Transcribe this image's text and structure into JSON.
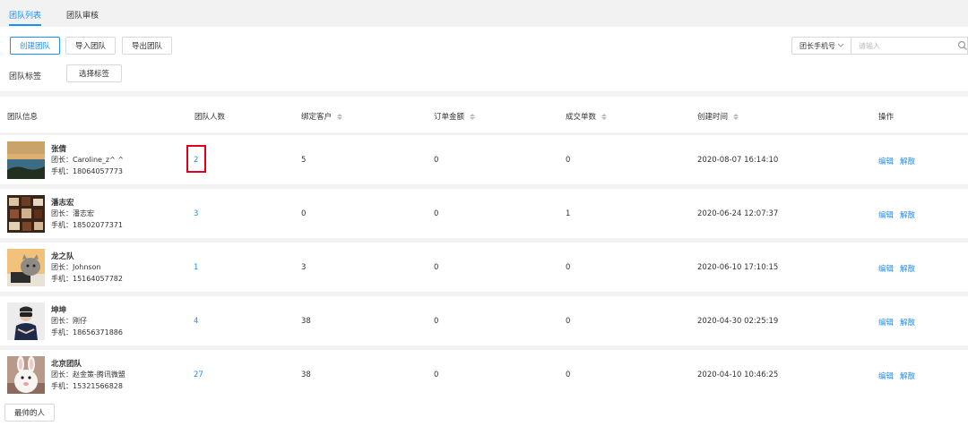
{
  "tabs": [
    "团队列表",
    "团队审核"
  ],
  "toolbar": {
    "create_label": "创建团队",
    "import_label": "导入团队",
    "export_label": "导出团队",
    "tag_label": "团队标签",
    "select_tag_label": "选择标签",
    "search_field_value": "团长手机号",
    "search_placeholder": "请输入"
  },
  "columns": [
    "团队信息",
    "团队人数",
    "绑定客户",
    "订单金额",
    "成交单数",
    "创建时间",
    "操作"
  ],
  "actions": {
    "edit": "编辑",
    "dissolve": "解散"
  },
  "rows": [
    {
      "name": "张倩",
      "leader": "团长：Caroline_z^ ^",
      "phone": "手机：18064057773",
      "members": "2",
      "customers": "5",
      "amount": "0",
      "orders": "0",
      "created": "2020-08-07 16:14:10",
      "avatar": "lake-landscape"
    },
    {
      "name": "潘志宏",
      "leader": "团长：潘志宏",
      "phone": "手机：18502077371",
      "members": "3",
      "customers": "0",
      "amount": "0",
      "orders": "1",
      "created": "2020-06-24 12:07:37",
      "avatar": "chocolates"
    },
    {
      "name": "龙之队",
      "leader": "团长：Johnson",
      "phone": "手机：15164057782",
      "members": "1",
      "customers": "3",
      "amount": "0",
      "orders": "0",
      "created": "2020-06-10 17:10:15",
      "avatar": "cat-laptop"
    },
    {
      "name": "坤坤",
      "leader": "团长：刚仔",
      "phone": "手机：18656371886",
      "members": "4",
      "customers": "38",
      "amount": "0",
      "orders": "0",
      "created": "2020-04-30 02:25:19",
      "avatar": "person-vr"
    },
    {
      "name": "北京团队",
      "leader": "团长：赵金策-腾讯微盟",
      "phone": "手机：15321566828",
      "members": "27",
      "customers": "38",
      "amount": "0",
      "orders": "0",
      "created": "2020-04-10 10:46:25",
      "avatar": "white-rabbit"
    }
  ],
  "footer": {
    "tag_chip": "最帅的人"
  },
  "colors": {
    "accent": "#1890ff",
    "highlight": "#e0001b"
  }
}
